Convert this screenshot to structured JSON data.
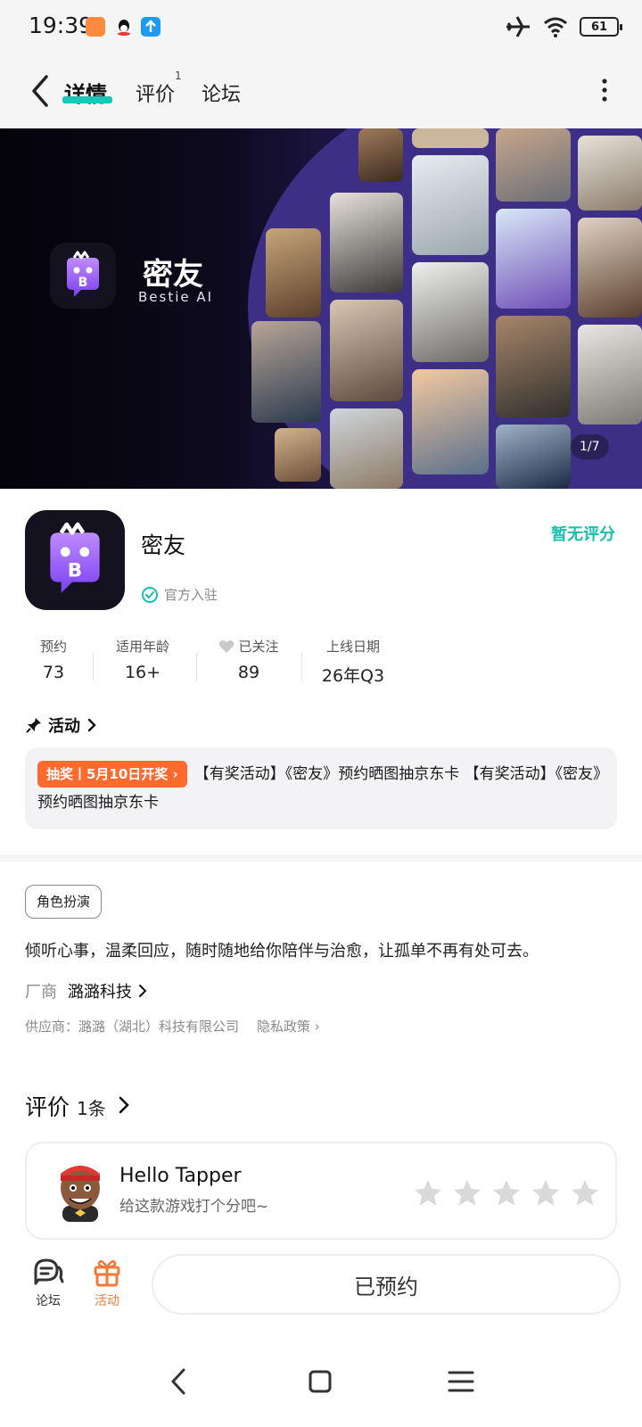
{
  "status_bar": {
    "time": "19:39",
    "battery": "61",
    "icons": [
      "taobao-icon",
      "qq-icon",
      "upload-icon",
      "airplane-mode-icon",
      "wifi-icon",
      "battery-icon"
    ]
  },
  "header": {
    "tabs": [
      {
        "label": "详情",
        "active": true
      },
      {
        "label": "评价",
        "superscript": "1"
      },
      {
        "label": "论坛"
      }
    ],
    "accent": "#17c7b8"
  },
  "banner": {
    "title": "密友",
    "subtitle": "Bestie AI",
    "pager": "1/7"
  },
  "app": {
    "name": "密友",
    "rating_status": "暂无评分",
    "official_label": "官方入驻"
  },
  "stats": [
    {
      "label": "预约",
      "value": "73"
    },
    {
      "label": "适用年龄",
      "value": "16+"
    },
    {
      "label": "已关注",
      "value": "89"
    },
    {
      "label": "上线日期",
      "value": "26年Q3"
    }
  ],
  "activity": {
    "heading": "活动",
    "badge": "抽奖丨5月10日开奖",
    "text": "【有奖活动】《密友》预约晒图抽京东卡 【有奖活动】《密友》预约晒图抽京东卡"
  },
  "details": {
    "tag": "角色扮演",
    "description": "倾听心事，温柔回应，随时随地给你陪伴与治愈，让孤单不再有处可去。",
    "vendor_label": "厂商",
    "vendor_name": "潞潞科技",
    "supplier": "供应商：潞潞（湖北）科技有限公司",
    "privacy": "隐私政策"
  },
  "reviews": {
    "title": "评价",
    "count": "1条",
    "card": {
      "name": "Hello Tapper",
      "prompt": "给这款游戏打个分吧~",
      "stars": 5
    }
  },
  "bottom_bar": {
    "forum": "论坛",
    "activity": "活动",
    "reserve_button": "已预约",
    "activity_color": "#f07a3a"
  },
  "colors": {
    "teal": "#17c0b0",
    "orange_badge": "#ff6a2f",
    "brand_purple": "#8a4bf0"
  }
}
